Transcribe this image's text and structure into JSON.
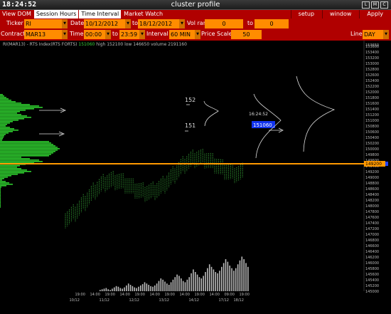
{
  "window": {
    "clock": "18:24:52",
    "title": "cluster profile",
    "buttons": [
      "L",
      "M",
      "C"
    ]
  },
  "menu": {
    "left": [
      "View DOM",
      "Session Hours",
      "Time Interval",
      "Market Watch"
    ],
    "active": "Session Hours",
    "right": [
      "setup",
      "window",
      "Apply"
    ]
  },
  "controls": {
    "ticker_label": "Ticker",
    "ticker": "RI",
    "date_label": "Date",
    "date_from": "10/12/2012",
    "to_label": "to",
    "date_to": "18/12/2012",
    "vol_range_label": "Vol range",
    "vol_from": "0",
    "vol_to_label": "to",
    "vol_to": "0",
    "contract_label": "Contract",
    "contract": "MAR13",
    "time_label": "Time",
    "time_from": "00:00",
    "time_to_label": "to",
    "time_to": "23:59",
    "interval_label": "Interval",
    "interval": "60 MIN",
    "price_scale_label": "Price Scale",
    "price_scale": "50",
    "line_label": "Line",
    "line": "DAY"
  },
  "chart_info": {
    "symbol": "RI(MAR13) - RTS Index(RTS FORTS)",
    "price": "151060",
    "high": "high 152100",
    "low": "low 146650",
    "volume": "volume 2191160"
  },
  "chart_data": {
    "type": "bar",
    "price_axis_ticks": [
      153650,
      153600,
      153400,
      153200,
      153000,
      152800,
      152600,
      152400,
      152200,
      152000,
      151800,
      151600,
      151400,
      151200,
      151000,
      150800,
      150600,
      150400,
      150200,
      150000,
      149800,
      149600,
      149400,
      149200,
      149000,
      148800,
      148600,
      148400,
      148200,
      148000,
      147800,
      147600,
      147400,
      147200,
      147000,
      146800,
      146600,
      146400,
      146200,
      146000,
      145800,
      145600,
      145400,
      145200,
      145000
    ],
    "ylim": [
      145000,
      153700
    ],
    "current_price": "151060",
    "current_time": "16:24:52",
    "orange_line_price": "149200",
    "x_tick_labels": [
      {
        "top": "19:00",
        "bottom": "10/12",
        "x": 0.5
      },
      {
        "top": "14:00",
        "bottom": "",
        "x": 1.5
      },
      {
        "top": "19:00",
        "bottom": "11/12",
        "x": 2.5
      },
      {
        "top": "14:00",
        "bottom": "",
        "x": 3.5
      },
      {
        "top": "19:00",
        "bottom": "12/12",
        "x": 4.5
      },
      {
        "top": "14:00",
        "bottom": "",
        "x": 5.5
      },
      {
        "top": "19:00",
        "bottom": "13/12",
        "x": 6.5
      },
      {
        "top": "14:00",
        "bottom": "",
        "x": 7.5
      },
      {
        "top": "19:00",
        "bottom": "14/12",
        "x": 8.5
      },
      {
        "top": "14:00",
        "bottom": "",
        "x": 9.5
      },
      {
        "top": "09:00",
        "bottom": "17/12",
        "x": 10.5
      },
      {
        "top": "19:00",
        "bottom": "18/12",
        "x": 11.5
      }
    ],
    "annotations": [
      "152",
      "151"
    ],
    "volume_bars": [
      2,
      3,
      4,
      5,
      3,
      2,
      4,
      6,
      8,
      7,
      5,
      4,
      6,
      9,
      12,
      10,
      8,
      6,
      5,
      7,
      9,
      11,
      14,
      12,
      10,
      8,
      7,
      9,
      12,
      16,
      20,
      18,
      15,
      12,
      10,
      14,
      18,
      22,
      26,
      24,
      20,
      16,
      14,
      18,
      22,
      28,
      34,
      30,
      26,
      22,
      20,
      24,
      30,
      36,
      42,
      38,
      34,
      30,
      28,
      32,
      38,
      44,
      50,
      46,
      40,
      36,
      32,
      36,
      42,
      48,
      54,
      50,
      44,
      38
    ]
  },
  "colors": {
    "menu_bg": "#b00000",
    "field_bg": "#ff8c00",
    "candles": "#2e8b2e",
    "profile": "#2ecc2e",
    "poc_line": "#ff9900",
    "price_tag": "#1133ee"
  }
}
